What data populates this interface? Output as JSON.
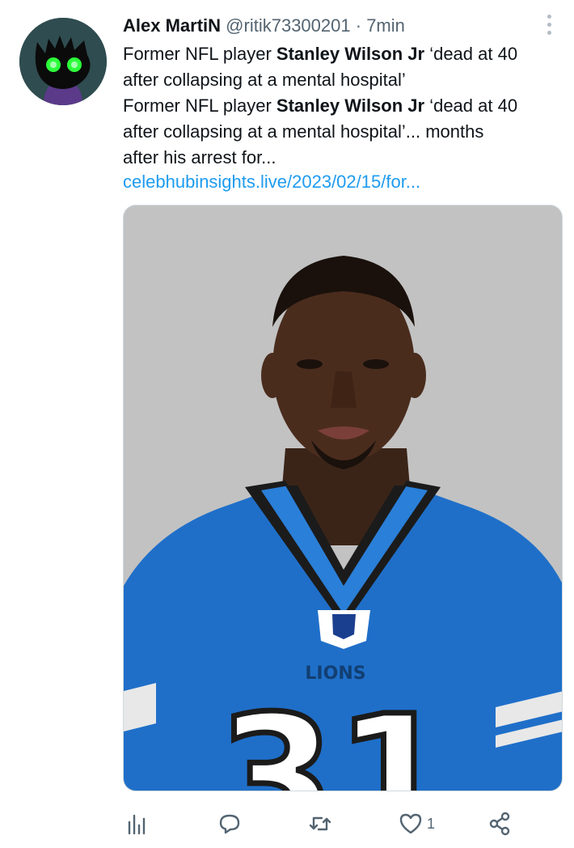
{
  "tweet": {
    "author_name": "Alex MartiN",
    "handle": "@ritik73300201",
    "separator": "·",
    "time": "7min",
    "line1_pre": "Former NFL player ",
    "line1_bold": "Stanley Wilson Jr",
    "line1_post": " ‘dead at 40",
    "line2": "after collapsing at a mental hospital’",
    "line3_pre": "Former NFL player ",
    "line3_bold": "Stanley Wilson Jr",
    "line3_post": " ‘dead at 40",
    "line4": "after collapsing at a mental hospital’... months",
    "line5": "after his arrest for...",
    "link": "celebhubinsights.live/2023/02/15/for...",
    "media": {
      "jersey_text": "LIONS",
      "jersey_number": "31"
    }
  },
  "actions": {
    "analytics_icon": "bar-chart-icon",
    "reply_icon": "speech-bubble-icon",
    "retweet_icon": "retweet-icon",
    "like_icon": "heart-icon",
    "like_count": "1",
    "share_icon": "share-icon"
  },
  "colors": {
    "link": "#1d9bf0",
    "secondary_text": "#536471",
    "jersey_blue": "#1f6fc9"
  }
}
